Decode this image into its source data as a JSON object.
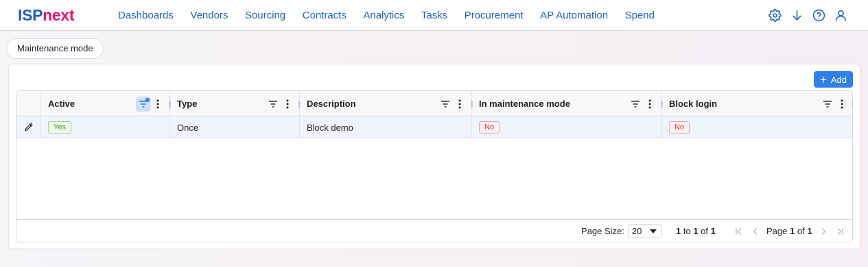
{
  "brand": {
    "part1": "ISP",
    "part2": "next"
  },
  "nav": [
    "Dashboards",
    "Vendors",
    "Sourcing",
    "Contracts",
    "Analytics",
    "Tasks",
    "Procurement",
    "AP Automation",
    "Spend"
  ],
  "top_icons": [
    "gear-icon",
    "download-icon",
    "help-icon",
    "user-icon"
  ],
  "chip": {
    "label": "Maintenance mode"
  },
  "add_button": {
    "label": "Add"
  },
  "columns": [
    {
      "label": "Active",
      "filter_active": true
    },
    {
      "label": "Type",
      "filter_active": false
    },
    {
      "label": "Description",
      "filter_active": false
    },
    {
      "label": "In maintenance mode",
      "filter_active": false
    },
    {
      "label": "Block login",
      "filter_active": false
    }
  ],
  "rows": [
    {
      "active": "Yes",
      "type": "Once",
      "description": "Block demo",
      "maintenance": "No",
      "block_login": "No"
    }
  ],
  "pagination": {
    "page_size_label": "Page Size:",
    "page_size": "20",
    "range_from": "1",
    "range_to_word": "to",
    "range_to": "1",
    "of_word": "of",
    "total": "1",
    "page_word": "Page",
    "current_page": "1",
    "page_of_word": "of",
    "page_count": "1"
  },
  "colors": {
    "brand_blue": "#1f5fae",
    "brand_pink": "#e0186a",
    "accent": "#2f80e8",
    "yes_green": "#3f8e2e",
    "no_red": "#d12f2f"
  }
}
